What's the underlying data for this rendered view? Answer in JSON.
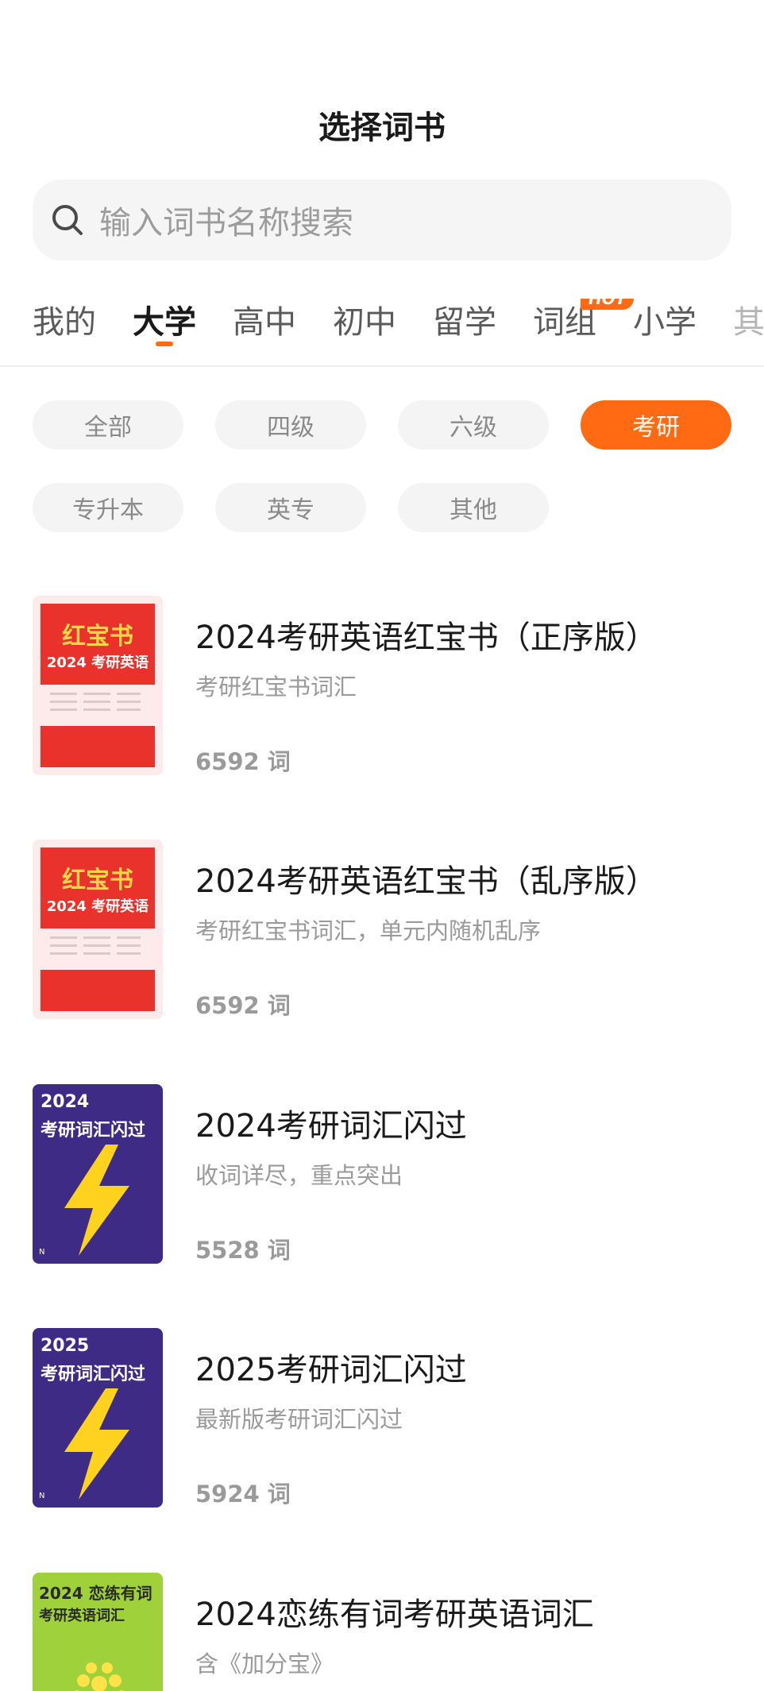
{
  "header": {
    "title": "选择词书"
  },
  "search": {
    "placeholder": "输入词书名称搜索",
    "icon": "search-icon"
  },
  "tabs": [
    {
      "label": "我的",
      "active": false
    },
    {
      "label": "大学",
      "active": true
    },
    {
      "label": "高中",
      "active": false
    },
    {
      "label": "初中",
      "active": false
    },
    {
      "label": "留学",
      "active": false
    },
    {
      "label": "词组",
      "active": false,
      "badge": "HOT"
    },
    {
      "label": "小学",
      "active": false
    },
    {
      "label": "其",
      "active": false
    }
  ],
  "filters": [
    {
      "label": "全部",
      "active": false
    },
    {
      "label": "四级",
      "active": false
    },
    {
      "label": "六级",
      "active": false
    },
    {
      "label": "考研",
      "active": true
    },
    {
      "label": "专升本",
      "active": false
    },
    {
      "label": "英专",
      "active": false
    },
    {
      "label": "其他",
      "active": false
    }
  ],
  "books": [
    {
      "title": "2024考研英语红宝书（正序版）",
      "desc": "考研红宝书词汇",
      "count": "6592 词",
      "cover": {
        "style": "red",
        "line1": "红宝书",
        "line2": "2024 考研英语"
      }
    },
    {
      "title": "2024考研英语红宝书（乱序版）",
      "desc": "考研红宝书词汇，单元内随机乱序",
      "count": "6592 词",
      "cover": {
        "style": "red",
        "line1": "红宝书",
        "line2": "2024 考研英语"
      }
    },
    {
      "title": "2024考研词汇闪过",
      "desc": "收词详尽，重点突出",
      "count": "5528 词",
      "cover": {
        "style": "purple",
        "line1": "2024",
        "line2": "考研词汇闪过",
        "corner": "N"
      }
    },
    {
      "title": "2025考研词汇闪过",
      "desc": "最新版考研词汇闪过",
      "count": "5924 词",
      "cover": {
        "style": "purple",
        "line1": "2025",
        "line2": "考研词汇闪过",
        "corner": "N"
      }
    },
    {
      "title": "2024恋练有词考研英语词汇",
      "desc": "含《加分宝》",
      "count": "",
      "cover": {
        "style": "green",
        "line1": "2024 恋练有词",
        "line2": "考研英语词汇"
      }
    }
  ],
  "colors": {
    "accent": "#ff6a13",
    "red_cover": "#e8322b",
    "purple_cover": "#3e2b86",
    "green_cover": "#9fd13a"
  }
}
